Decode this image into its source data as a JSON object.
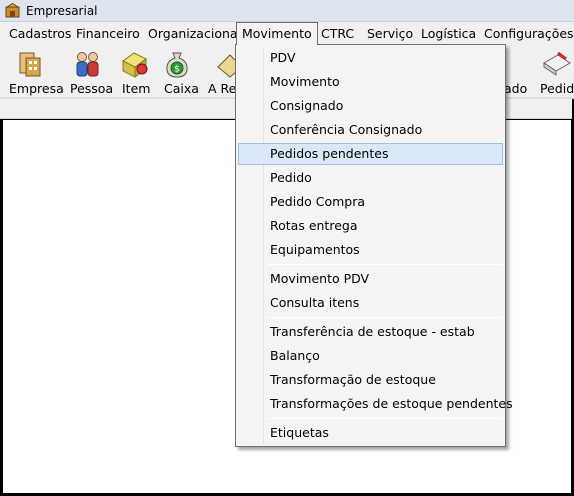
{
  "window": {
    "title": "Empresarial",
    "app_icon": "app-logo-icon"
  },
  "menubar": {
    "items": [
      {
        "label": "Cadastros"
      },
      {
        "label": "Financeiro"
      },
      {
        "label": "Organizacional"
      },
      {
        "label": "Movimento"
      },
      {
        "label": "CTRC"
      },
      {
        "label": "Serviço"
      },
      {
        "label": "Logística"
      },
      {
        "label": "Configurações"
      }
    ]
  },
  "toolbar": {
    "buttons": [
      {
        "label": "Empresa",
        "icon": "company-icon"
      },
      {
        "label": "Pessoa",
        "icon": "people-icon"
      },
      {
        "label": "Item",
        "icon": "item-icon"
      },
      {
        "label": "Caixa",
        "icon": "cash-bag-icon"
      },
      {
        "label": "A Rec",
        "icon": "receivable-icon"
      },
      {
        "label": "ado",
        "icon": "hidden-icon"
      },
      {
        "label": "Pedid",
        "icon": "order-icon"
      }
    ]
  },
  "dropdown": {
    "items": [
      "PDV",
      "Movimento",
      "Consignado",
      "Conferência Consignado",
      "Pedidos pendentes",
      "Pedido",
      "Pedido Compra",
      "Rotas entrega",
      "Equipamentos",
      "Movimento PDV",
      "Consulta itens",
      "Transferência de estoque - estab",
      "Balanço",
      "Transformação de estoque",
      "Transformações de estoque pendentes",
      "Etiquetas"
    ],
    "highlighted": "Pedidos pendentes"
  },
  "colors": {
    "highlight_bg": "#dbe8f7",
    "highlight_border": "#9ec1e8",
    "menu_bg": "#f0f0f0"
  }
}
